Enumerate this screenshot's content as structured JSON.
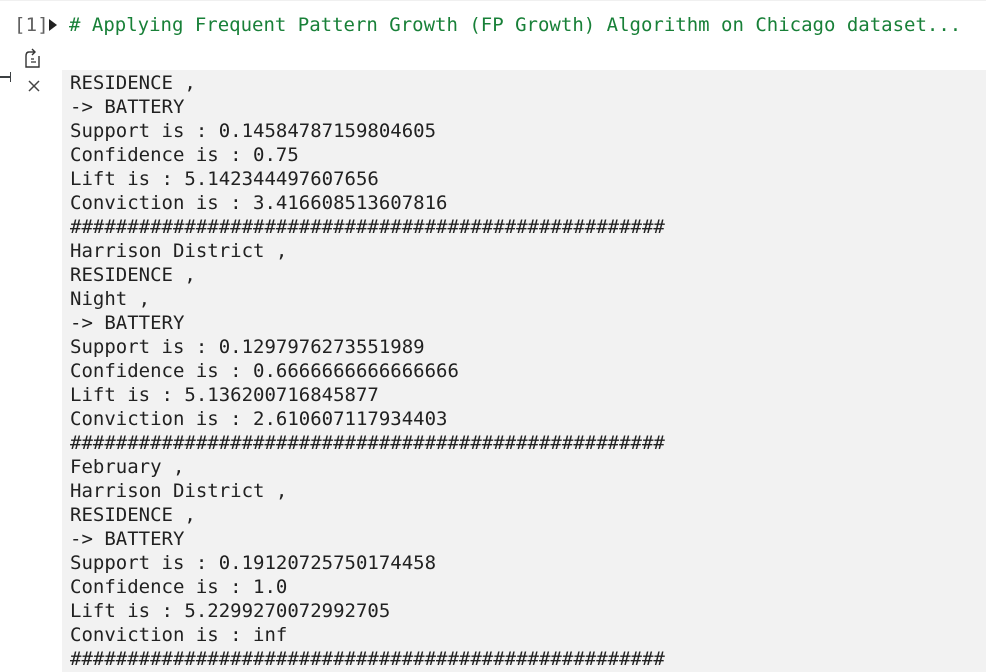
{
  "cell": {
    "execution_count": "[1]",
    "code_preview": "# Applying Frequent Pattern Growth (FP Growth) Algorithm on Chicago dataset..."
  },
  "icons": {
    "output_icon": "output-expand-icon",
    "clear_icon": "close-icon"
  },
  "colors": {
    "code_comment": "#188038",
    "output_background": "#f2f2f2",
    "text": "#212121"
  },
  "output": {
    "lines": [
      "RESIDENCE ,",
      "-> BATTERY",
      "Support is : 0.14584787159804605",
      "Confidence is : 0.75",
      "Lift is : 5.142344497607656",
      "Conviction is : 3.416608513607816",
      "####################################################",
      "Harrison District ,",
      "RESIDENCE ,",
      "Night ,",
      "-> BATTERY",
      "Support is : 0.1297976273551989",
      "Confidence is : 0.6666666666666666",
      "Lift is : 5.136200716845877",
      "Conviction is : 2.610607117934403",
      "####################################################",
      "February ,",
      "Harrison District ,",
      "RESIDENCE ,",
      "-> BATTERY",
      "Support is : 0.19120725750174458",
      "Confidence is : 1.0",
      "Lift is : 5.2299270072992705",
      "Conviction is : inf",
      "####################################################"
    ]
  }
}
